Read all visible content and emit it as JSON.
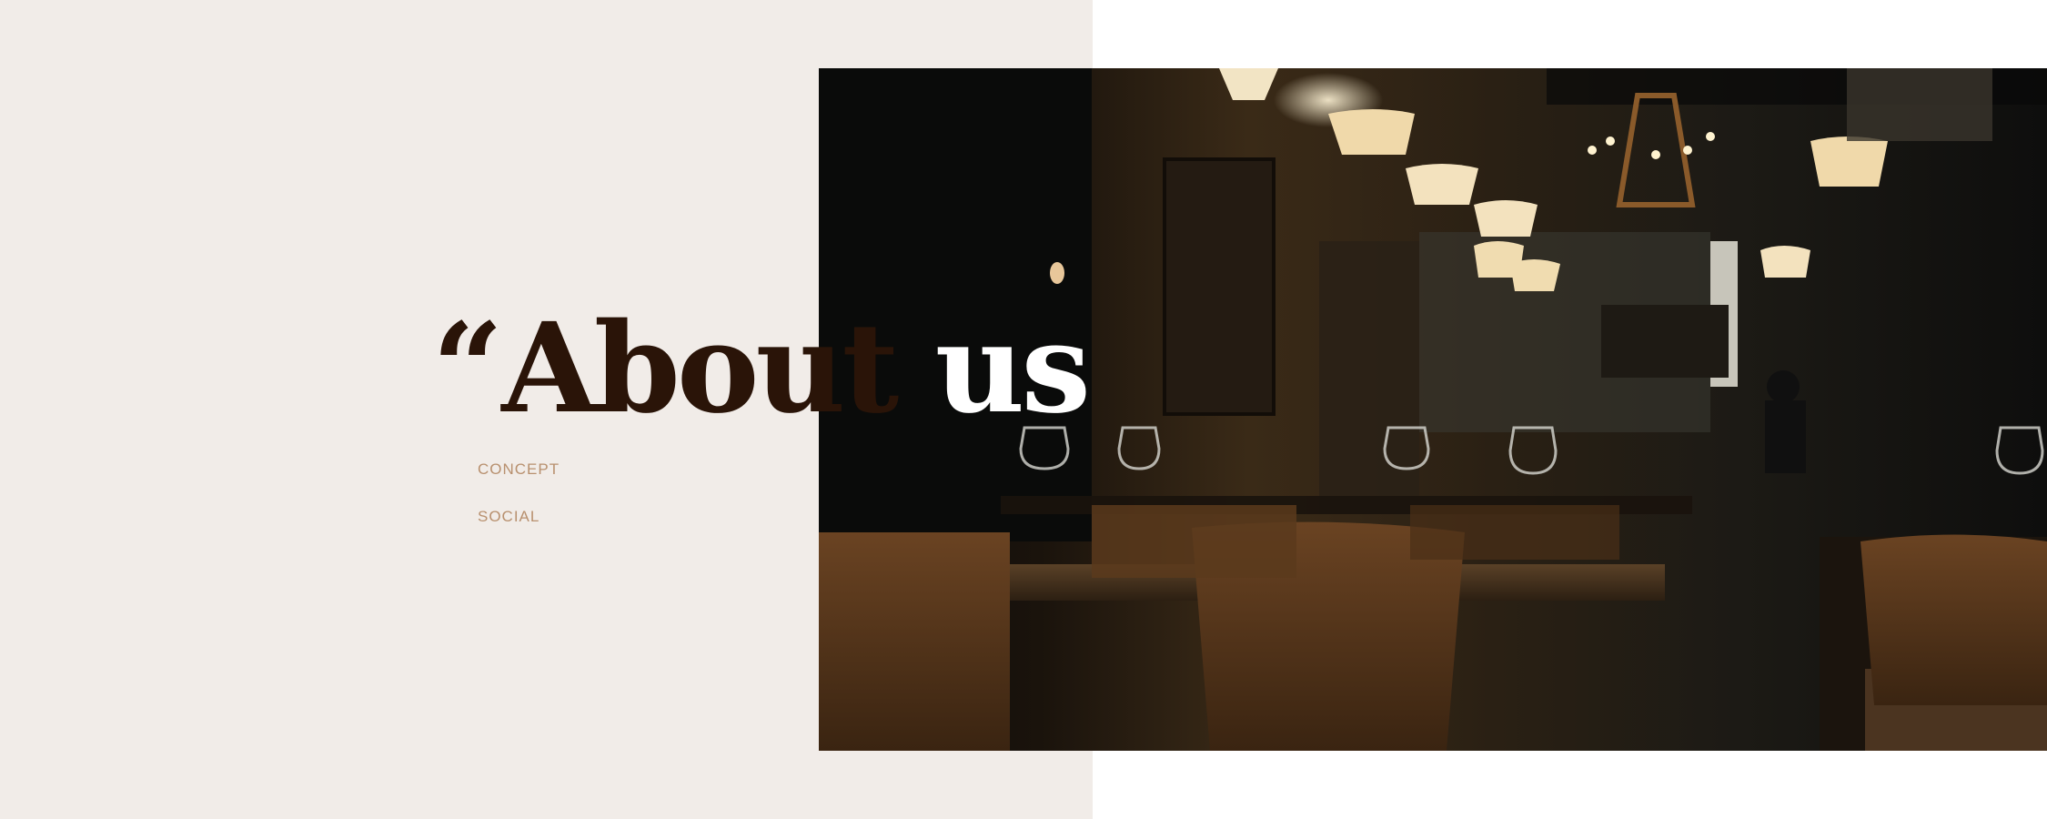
{
  "hero": {
    "quote_mark": "“",
    "title_dark": "About ",
    "title_light": "us"
  },
  "nav": {
    "items": [
      {
        "label": "CONCEPT"
      },
      {
        "label": "SOCIAL"
      }
    ]
  },
  "colors": {
    "panel_background": "#f1ece8",
    "heading_dark": "#2a1408",
    "heading_light": "#ffffff",
    "nav_link": "#b8906e"
  },
  "image": {
    "subject": "restaurant-interior-photo"
  }
}
